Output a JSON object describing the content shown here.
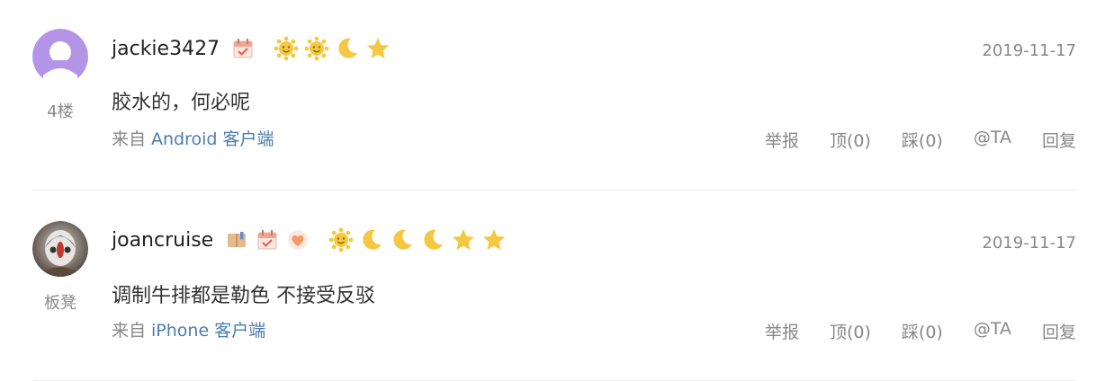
{
  "comments": [
    {
      "username": "jackie3427",
      "floor": "4楼",
      "date": "2019-11-17",
      "content": "胶水的，何必呢",
      "source_prefix": "来自",
      "device": "Android 客户端",
      "badges": [
        "calendar-badge-icon"
      ],
      "levels": [
        "sun-icon",
        "sun-icon",
        "moon-icon",
        "star-icon"
      ],
      "actions": {
        "report": "举报",
        "up": "顶(0)",
        "down": "踩(0)",
        "at": "@TA",
        "reply": "回复"
      }
    },
    {
      "username": "joancruise",
      "floor": "板凳",
      "date": "2019-11-17",
      "content": "调制牛排都是勒色 不接受反驳",
      "source_prefix": "来自",
      "device": "iPhone 客户端",
      "badges": [
        "book-badge-icon",
        "calendar-badge-icon",
        "heart-badge-icon"
      ],
      "levels": [
        "sun-icon",
        "moon-icon",
        "moon-icon",
        "moon-icon",
        "star-icon",
        "star-icon"
      ],
      "actions": {
        "report": "举报",
        "up": "顶(0)",
        "down": "踩(0)",
        "at": "@TA",
        "reply": "回复"
      }
    }
  ],
  "colors": {
    "link": "#4a7db0",
    "muted": "#888888",
    "level_gold": "#f5c842",
    "avatar_default": "#b394e6"
  }
}
